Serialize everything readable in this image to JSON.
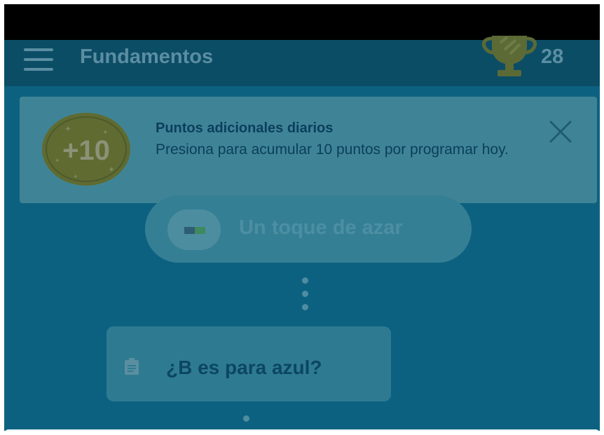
{
  "app_bar": {
    "title": "Fundamentos",
    "score": "28",
    "menu_icon": "hamburger-menu-icon",
    "trophy_icon": "trophy-icon"
  },
  "banner": {
    "badge": "+10",
    "title": "Puntos adicionales diarios",
    "text": "Presiona para acumular 10 puntos por programar hoy.",
    "close_icon": "close-icon"
  },
  "path": {
    "node_label": "Un toque de azar",
    "node_icon": "flag-icon",
    "card_label": "¿B es para azul?",
    "card_icon": "clipboard-icon"
  },
  "colors": {
    "background": "#0d6180",
    "app_bar": "#0c4d66",
    "banner": "#3f8496",
    "text_dark": "#0b3e5c"
  }
}
